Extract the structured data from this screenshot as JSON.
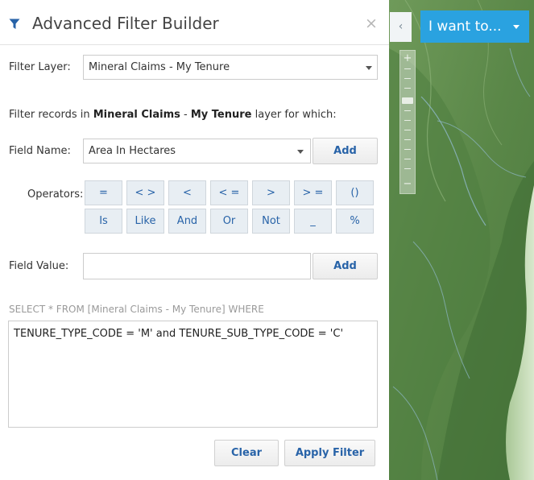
{
  "panel": {
    "title": "Advanced Filter Builder",
    "close_label": "×",
    "filter_layer": {
      "label": "Filter Layer:",
      "value": "Mineral Claims - My Tenure"
    },
    "description": {
      "prefix": "Filter records in ",
      "part1": "Mineral Claims",
      "separator": " - ",
      "part2": "My Tenure",
      "suffix": " layer for which:"
    },
    "field_name": {
      "label": "Field Name:",
      "value": "Area In Hectares",
      "add_label": "Add"
    },
    "operators": {
      "label": "Operators:",
      "row1": [
        "=",
        "< >",
        "<",
        "< =",
        ">",
        "> =",
        "()"
      ],
      "row2": [
        "Is",
        "Like",
        "And",
        "Or",
        "Not",
        "_",
        "%"
      ]
    },
    "field_value": {
      "label": "Field Value:",
      "value": "",
      "add_label": "Add"
    },
    "sql": {
      "prefix": "SELECT * FROM [Mineral Claims - My Tenure] WHERE",
      "expression": "TENURE_TYPE_CODE = 'M' and TENURE_SUB_TYPE_CODE = 'C'"
    },
    "buttons": {
      "clear": "Clear",
      "apply": "Apply Filter"
    }
  },
  "map": {
    "collapse_label": "‹",
    "i_want_to_label": "I want to...",
    "zoom_in_label": "+",
    "zoom_out_label": "−",
    "zoom_level_fraction": 0.6
  },
  "colors": {
    "accent_blue": "#2aa2e0",
    "link_blue": "#2863a8",
    "operator_bg": "#e8eef3",
    "map_green": "#5f8f4c"
  },
  "icons": {
    "title": "filter-icon",
    "close": "close-icon",
    "select_caret": "chevron-down-icon",
    "collapse": "chevron-left-icon",
    "i_want_caret": "caret-down-icon"
  }
}
